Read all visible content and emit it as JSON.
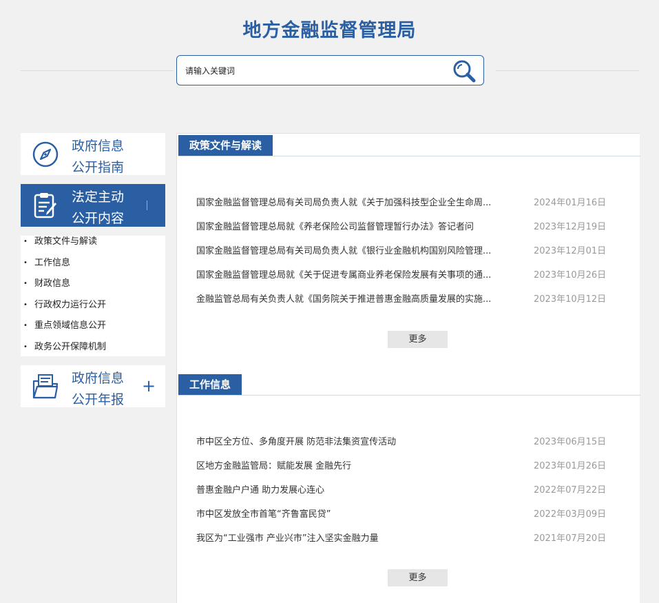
{
  "header": {
    "site_title": "地方金融监督管理局"
  },
  "search": {
    "placeholder": "请输入关键词"
  },
  "sidebar": {
    "guide": {
      "line1": "政府信息",
      "line2": "公开指南"
    },
    "content": {
      "line1": "法定主动",
      "line2": "公开内容"
    },
    "sub_items": [
      {
        "label": "政策文件与解读"
      },
      {
        "label": "工作信息"
      },
      {
        "label": "财政信息"
      },
      {
        "label": "行政权力运行公开"
      },
      {
        "label": "重点领域信息公开"
      },
      {
        "label": "政务公开保障机制"
      }
    ],
    "annual": {
      "line1": "政府信息",
      "line2": "公开年报",
      "expand": "+"
    }
  },
  "sections": [
    {
      "title": "政策文件与解读",
      "more": "更多",
      "items": [
        {
          "title": "国家金融监督管理总局有关司局负责人就《关于加强科技型企业全生命周...",
          "date": "2024年01月16日"
        },
        {
          "title": "国家金融监督管理总局就《养老保险公司监督管理暂行办法》答记者问",
          "date": "2023年12月19日"
        },
        {
          "title": "国家金融监督管理总局有关司局负责人就《银行业金融机构国别风险管理...",
          "date": "2023年12月01日"
        },
        {
          "title": "国家金融监督管理总局就《关于促进专属商业养老保险发展有关事项的通...",
          "date": "2023年10月26日"
        },
        {
          "title": "金融监管总局有关负责人就《国务院关于推进普惠金融高质量发展的实施...",
          "date": "2023年10月12日"
        }
      ]
    },
    {
      "title": "工作信息",
      "more": "更多",
      "items": [
        {
          "title": "市中区全方位、多角度开展 防范非法集资宣传活动",
          "date": "2023年06月15日"
        },
        {
          "title": "区地方金融监管局：赋能发展 金融先行",
          "date": "2023年01月26日"
        },
        {
          "title": "普惠金融户户通 助力发展心连心",
          "date": "2022年07月22日"
        },
        {
          "title": "市中区发放全市首笔“齐鲁富民贷”",
          "date": "2022年03月09日"
        },
        {
          "title": "我区为“工业强市 产业兴市”注入坚实金融力量",
          "date": "2021年07月20日"
        }
      ]
    }
  ],
  "colors": {
    "brand": "#2a5fa3",
    "date": "#999999",
    "background": "#f1f1f1"
  },
  "icons": [
    "compass-icon",
    "clipboard-edit-icon",
    "folder-document-icon",
    "search-icon"
  ]
}
